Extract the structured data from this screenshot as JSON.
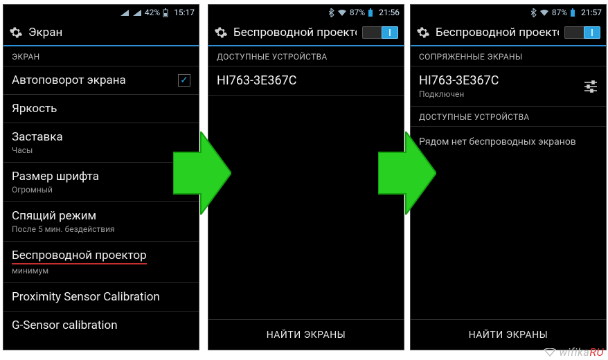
{
  "wm_text": "wifika",
  "wm_suffix": "RU",
  "phone1": {
    "status": {
      "pct": "42%",
      "time": "15:17"
    },
    "title": "Экран",
    "section": "ЭКРАН",
    "items": {
      "autorotate": "Автоповорот экрана",
      "brightness": "Яркость",
      "screensaver": "Заставка",
      "screensaver_sub": "Часы",
      "font": "Размер шрифта",
      "font_sub": "Огромный",
      "sleep": "Спящий режим",
      "sleep_sub": "После 5 мин. бездействия",
      "wproj": "Беспроводной проектор",
      "wproj_sub": "минимум",
      "prox": "Proximity Sensor Calibration",
      "gsens": "G-Sensor calibration"
    }
  },
  "phone2": {
    "status": {
      "pct": "87%",
      "time": "21:56"
    },
    "title": "Беспроводной проектор",
    "section_avail": "ДОСТУПНЫЕ УСТРОЙСТВА",
    "device": "HI763-3E367C",
    "bottom": "НАЙТИ ЭКРАНЫ"
  },
  "phone3": {
    "status": {
      "pct": "87%",
      "time": "21:57"
    },
    "title": "Беспроводной проектор",
    "section_paired": "СОПРЯЖЕННЫЕ ЭКРАНЫ",
    "device": "HI763-3E367C",
    "device_sub": "Подключен",
    "section_avail": "ДОСТУПНЫЕ УСТРОЙСТВА",
    "empty": "Рядом нет беспроводных экранов",
    "bottom": "НАЙТИ ЭКРАНЫ"
  }
}
